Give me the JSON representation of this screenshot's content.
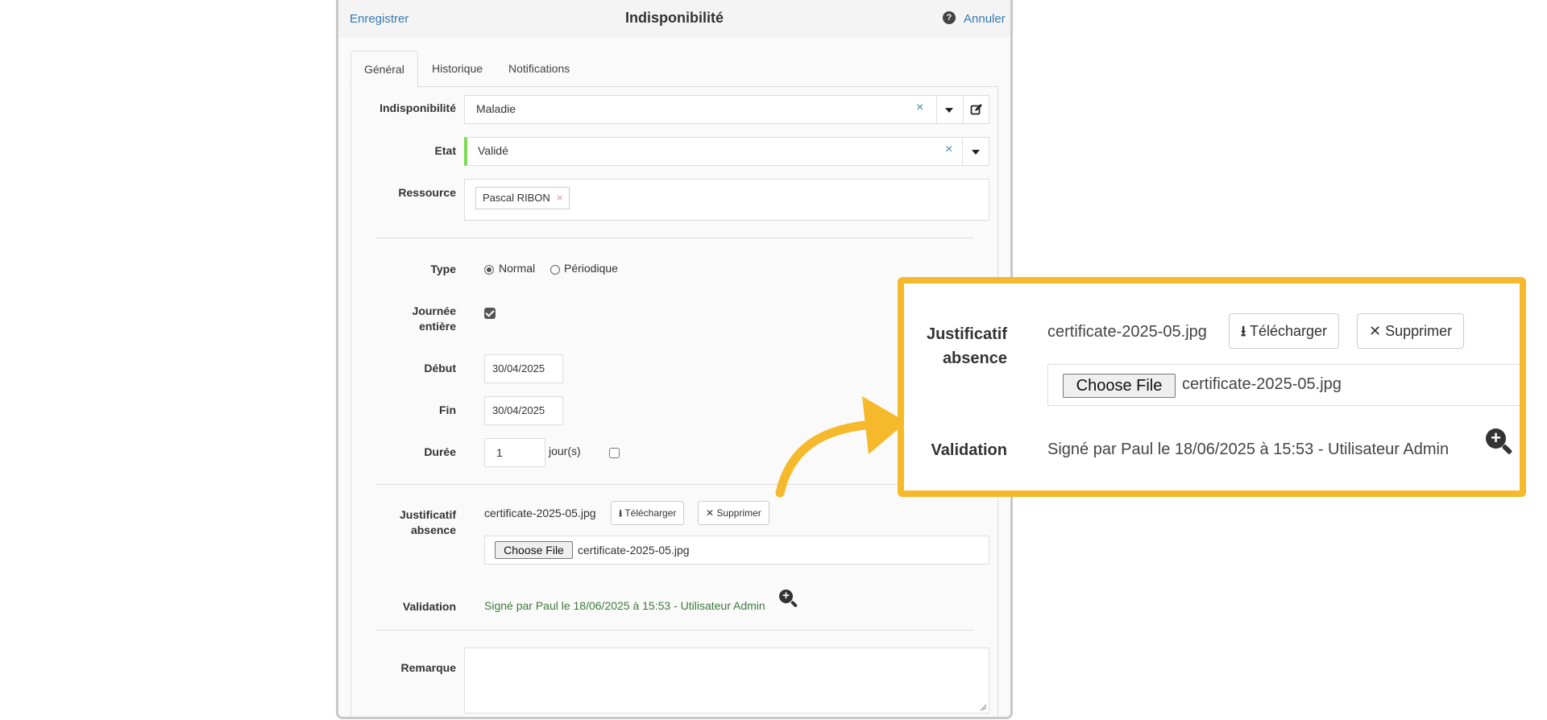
{
  "header": {
    "save_label": "Enregistrer",
    "title": "Indisponibilité",
    "help_icon": "?",
    "cancel_label": "Annuler"
  },
  "tabs": [
    {
      "label": "Général",
      "active": true
    },
    {
      "label": "Historique",
      "active": false
    },
    {
      "label": "Notifications",
      "active": false
    }
  ],
  "form": {
    "indisponibilite": {
      "label": "Indisponibilité",
      "value": "Maladie",
      "clear": "×"
    },
    "etat": {
      "label": "Etat",
      "value": "Validé",
      "clear": "×",
      "status_color": "#7ed957"
    },
    "ressource": {
      "label": "Ressource",
      "tags": [
        "Pascal RIBON"
      ],
      "tag_remove": "×"
    },
    "type": {
      "label": "Type",
      "options": [
        "Normal",
        "Périodique"
      ],
      "selected": "Normal"
    },
    "journee_entiere": {
      "label_line1": "Journée",
      "label_line2": "entière",
      "checked": true
    },
    "debut": {
      "label": "Début",
      "value": "30/04/2025"
    },
    "fin": {
      "label": "Fin",
      "value": "30/04/2025"
    },
    "duree": {
      "label": "Durée",
      "value": "1",
      "unit": "jour(s)",
      "checked": false
    },
    "justificatif": {
      "label_line1": "Justificatif",
      "label_line2": "absence",
      "file_name": "certificate-2025-05.jpg",
      "download_label": "Télécharger",
      "delete_label": "Supprimer",
      "choose_file_label": "Choose File",
      "chosen_file": "certificate-2025-05.jpg"
    },
    "validation": {
      "label": "Validation",
      "text": "Signé par Paul le 18/06/2025 à 15:53 - Utilisateur Admin",
      "icon": "zoom-in-icon"
    },
    "remarque": {
      "label": "Remarque",
      "value": ""
    }
  },
  "callout": {
    "border_color": "#f6b92b",
    "arrow_color": "#f6b92b"
  },
  "colors": {
    "link": "#337ab7",
    "validation_text": "#3d7a3a"
  }
}
